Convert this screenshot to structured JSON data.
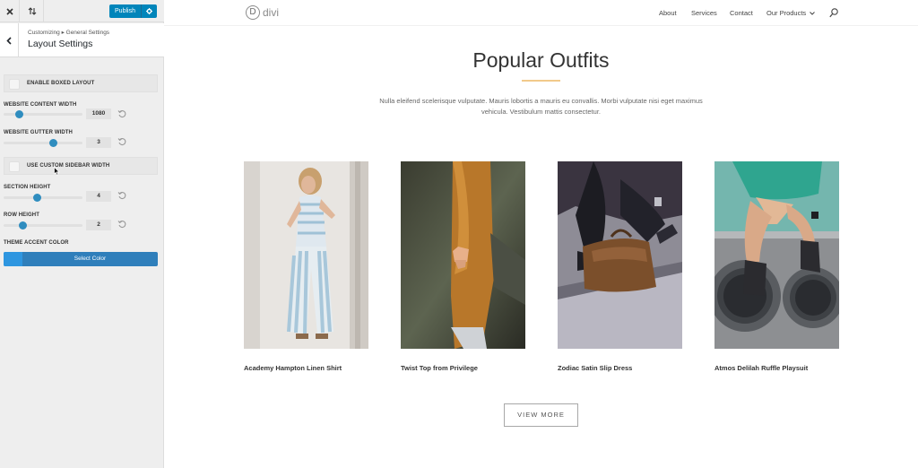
{
  "customizer": {
    "publish_label": "Publish",
    "breadcrumb": "Customizing ▸ General Settings",
    "section_title": "Layout Settings",
    "enable_boxed_layout": "ENABLE BOXED LAYOUT",
    "content_width": {
      "label": "WEBSITE CONTENT WIDTH",
      "value": "1080",
      "fraction": 0.16
    },
    "gutter_width": {
      "label": "WEBSITE GUTTER WIDTH",
      "value": "3",
      "fraction": 0.65
    },
    "custom_sidebar": "USE CUSTOM SIDEBAR WIDTH",
    "section_height": {
      "label": "SECTION HEIGHT",
      "value": "4",
      "fraction": 0.42
    },
    "row_height": {
      "label": "ROW HEIGHT",
      "value": "2",
      "fraction": 0.22
    },
    "accent_label": "THEME ACCENT COLOR",
    "select_color": "Select Color",
    "accent_color": "#2e96e0"
  },
  "site": {
    "logo_mark": "D",
    "logo_word": "divi",
    "menu": [
      "About",
      "Services",
      "Contact",
      "Our Products"
    ],
    "heading": "Popular Outfits",
    "intro": "Nulla eleifend scelerisque vulputate. Mauris lobortis a mauris eu convallis. Morbi vulputate nisi eget maximus vehicula. Vestibulum mattis consectetur.",
    "products": [
      "Academy Hampton Linen Shirt",
      "Twist Top from Privilege",
      "Zodiac Satin Slip Dress",
      "Atmos Delilah Ruffle Playsuit"
    ],
    "view_more": "VIEW MORE"
  }
}
